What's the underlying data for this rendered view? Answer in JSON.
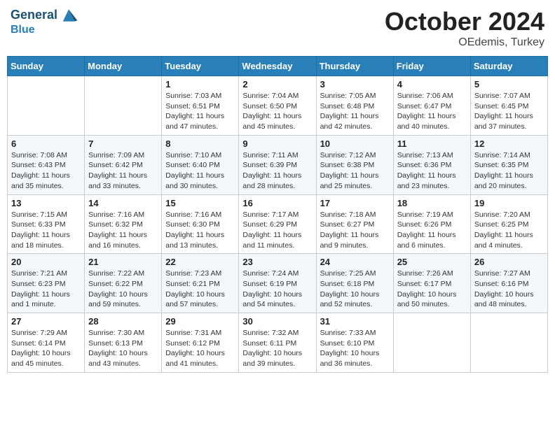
{
  "header": {
    "logo_line1": "General",
    "logo_line2": "Blue",
    "month": "October 2024",
    "location": "OEdemis, Turkey"
  },
  "days_of_week": [
    "Sunday",
    "Monday",
    "Tuesday",
    "Wednesday",
    "Thursday",
    "Friday",
    "Saturday"
  ],
  "weeks": [
    [
      {
        "day": "",
        "info": ""
      },
      {
        "day": "",
        "info": ""
      },
      {
        "day": "1",
        "info": "Sunrise: 7:03 AM\nSunset: 6:51 PM\nDaylight: 11 hours and 47 minutes."
      },
      {
        "day": "2",
        "info": "Sunrise: 7:04 AM\nSunset: 6:50 PM\nDaylight: 11 hours and 45 minutes."
      },
      {
        "day": "3",
        "info": "Sunrise: 7:05 AM\nSunset: 6:48 PM\nDaylight: 11 hours and 42 minutes."
      },
      {
        "day": "4",
        "info": "Sunrise: 7:06 AM\nSunset: 6:47 PM\nDaylight: 11 hours and 40 minutes."
      },
      {
        "day": "5",
        "info": "Sunrise: 7:07 AM\nSunset: 6:45 PM\nDaylight: 11 hours and 37 minutes."
      }
    ],
    [
      {
        "day": "6",
        "info": "Sunrise: 7:08 AM\nSunset: 6:43 PM\nDaylight: 11 hours and 35 minutes."
      },
      {
        "day": "7",
        "info": "Sunrise: 7:09 AM\nSunset: 6:42 PM\nDaylight: 11 hours and 33 minutes."
      },
      {
        "day": "8",
        "info": "Sunrise: 7:10 AM\nSunset: 6:40 PM\nDaylight: 11 hours and 30 minutes."
      },
      {
        "day": "9",
        "info": "Sunrise: 7:11 AM\nSunset: 6:39 PM\nDaylight: 11 hours and 28 minutes."
      },
      {
        "day": "10",
        "info": "Sunrise: 7:12 AM\nSunset: 6:38 PM\nDaylight: 11 hours and 25 minutes."
      },
      {
        "day": "11",
        "info": "Sunrise: 7:13 AM\nSunset: 6:36 PM\nDaylight: 11 hours and 23 minutes."
      },
      {
        "day": "12",
        "info": "Sunrise: 7:14 AM\nSunset: 6:35 PM\nDaylight: 11 hours and 20 minutes."
      }
    ],
    [
      {
        "day": "13",
        "info": "Sunrise: 7:15 AM\nSunset: 6:33 PM\nDaylight: 11 hours and 18 minutes."
      },
      {
        "day": "14",
        "info": "Sunrise: 7:16 AM\nSunset: 6:32 PM\nDaylight: 11 hours and 16 minutes."
      },
      {
        "day": "15",
        "info": "Sunrise: 7:16 AM\nSunset: 6:30 PM\nDaylight: 11 hours and 13 minutes."
      },
      {
        "day": "16",
        "info": "Sunrise: 7:17 AM\nSunset: 6:29 PM\nDaylight: 11 hours and 11 minutes."
      },
      {
        "day": "17",
        "info": "Sunrise: 7:18 AM\nSunset: 6:27 PM\nDaylight: 11 hours and 9 minutes."
      },
      {
        "day": "18",
        "info": "Sunrise: 7:19 AM\nSunset: 6:26 PM\nDaylight: 11 hours and 6 minutes."
      },
      {
        "day": "19",
        "info": "Sunrise: 7:20 AM\nSunset: 6:25 PM\nDaylight: 11 hours and 4 minutes."
      }
    ],
    [
      {
        "day": "20",
        "info": "Sunrise: 7:21 AM\nSunset: 6:23 PM\nDaylight: 11 hours and 1 minute."
      },
      {
        "day": "21",
        "info": "Sunrise: 7:22 AM\nSunset: 6:22 PM\nDaylight: 10 hours and 59 minutes."
      },
      {
        "day": "22",
        "info": "Sunrise: 7:23 AM\nSunset: 6:21 PM\nDaylight: 10 hours and 57 minutes."
      },
      {
        "day": "23",
        "info": "Sunrise: 7:24 AM\nSunset: 6:19 PM\nDaylight: 10 hours and 54 minutes."
      },
      {
        "day": "24",
        "info": "Sunrise: 7:25 AM\nSunset: 6:18 PM\nDaylight: 10 hours and 52 minutes."
      },
      {
        "day": "25",
        "info": "Sunrise: 7:26 AM\nSunset: 6:17 PM\nDaylight: 10 hours and 50 minutes."
      },
      {
        "day": "26",
        "info": "Sunrise: 7:27 AM\nSunset: 6:16 PM\nDaylight: 10 hours and 48 minutes."
      }
    ],
    [
      {
        "day": "27",
        "info": "Sunrise: 7:29 AM\nSunset: 6:14 PM\nDaylight: 10 hours and 45 minutes."
      },
      {
        "day": "28",
        "info": "Sunrise: 7:30 AM\nSunset: 6:13 PM\nDaylight: 10 hours and 43 minutes."
      },
      {
        "day": "29",
        "info": "Sunrise: 7:31 AM\nSunset: 6:12 PM\nDaylight: 10 hours and 41 minutes."
      },
      {
        "day": "30",
        "info": "Sunrise: 7:32 AM\nSunset: 6:11 PM\nDaylight: 10 hours and 39 minutes."
      },
      {
        "day": "31",
        "info": "Sunrise: 7:33 AM\nSunset: 6:10 PM\nDaylight: 10 hours and 36 minutes."
      },
      {
        "day": "",
        "info": ""
      },
      {
        "day": "",
        "info": ""
      }
    ]
  ]
}
